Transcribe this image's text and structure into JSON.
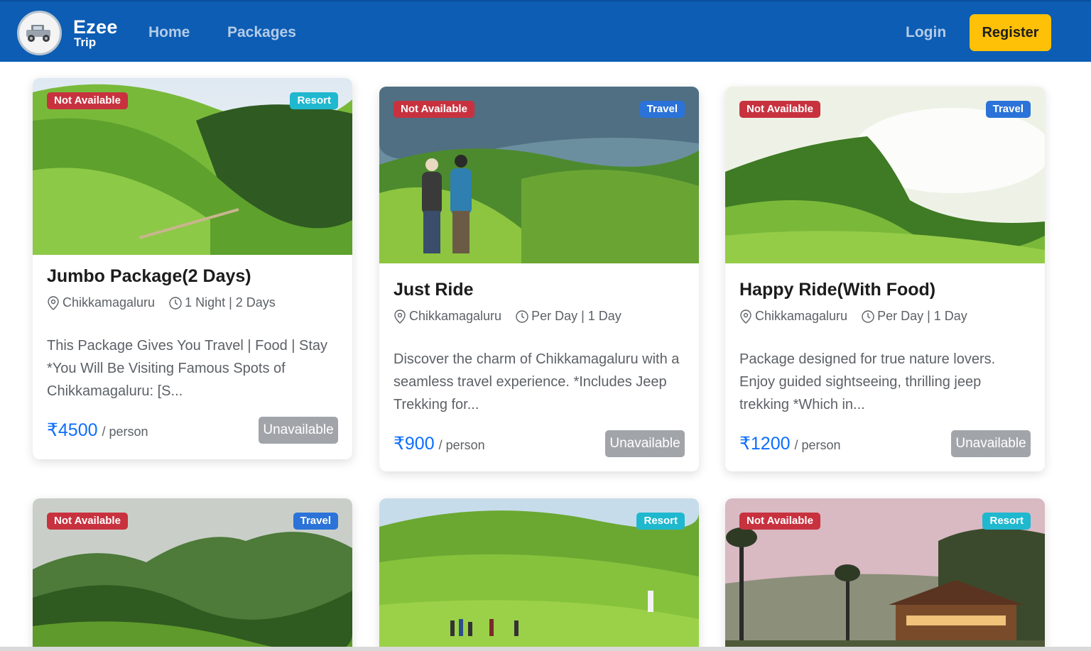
{
  "nav": {
    "brand_main": "Ezee",
    "brand_sub": "Trip",
    "home": "Home",
    "packages": "Packages",
    "login": "Login",
    "register": "Register"
  },
  "colors": {
    "navbar": "#0c5db3",
    "register": "#ffc107",
    "not_available": "#c8323f",
    "travel": "#2b73d9",
    "resort": "#1fb8cf",
    "price": "#0d6efd",
    "unavailable_button": "#a1a5aa"
  },
  "cards": [
    {
      "status": "Not Available",
      "type": "Resort",
      "title": "Jumbo Package(2 Days)",
      "location": "Chikkamagaluru",
      "duration": "1 Night | 2 Days",
      "description": "This Package Gives You Travel | Food | Stay *You Will Be Visiting Famous Spots of Chikkamagaluru: [S...",
      "price": "₹4500",
      "price_unit": "/ person",
      "button": "Unavailable"
    },
    {
      "status": "Not Available",
      "type": "Travel",
      "title": "Just Ride",
      "location": "Chikkamagaluru",
      "duration": "Per Day | 1 Day",
      "description": "Discover the charm of Chikkamagaluru with a seamless travel experience. *Includes Jeep Trekking for...",
      "price": "₹900",
      "price_unit": "/ person",
      "button": "Unavailable"
    },
    {
      "status": "Not Available",
      "type": "Travel",
      "title": "Happy Ride(With Food)",
      "location": "Chikkamagaluru",
      "duration": "Per Day | 1 Day",
      "description": "Package designed for true nature lovers. Enjoy guided sightseeing, thrilling jeep trekking *Which in...",
      "price": "₹1200",
      "price_unit": "/ person",
      "button": "Unavailable"
    },
    {
      "status": "Not Available",
      "type": "Travel"
    },
    {
      "type": "Resort"
    },
    {
      "status": "Not Available",
      "type": "Resort"
    }
  ]
}
